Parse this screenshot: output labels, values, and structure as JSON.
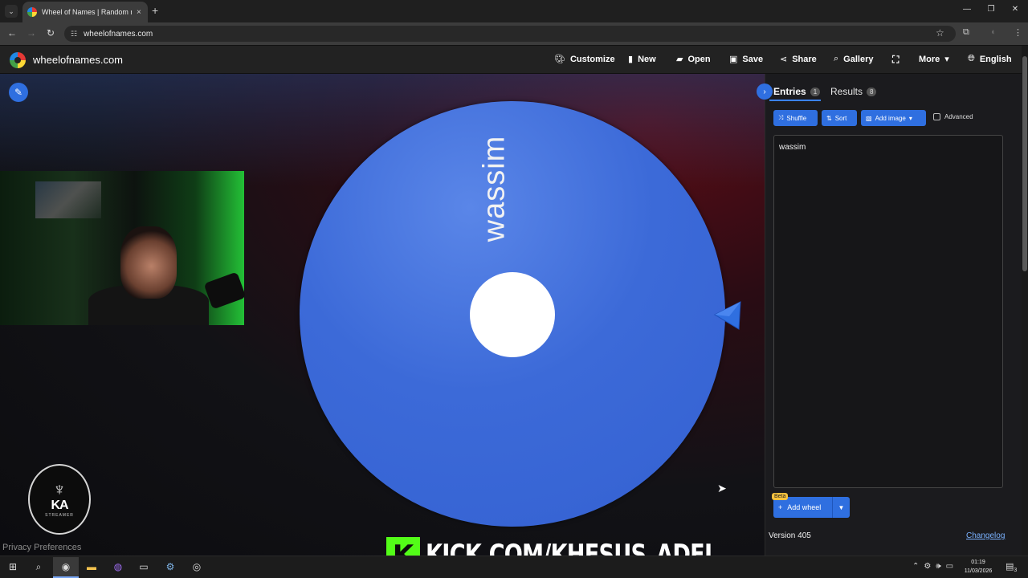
{
  "browser": {
    "tab_title": "Wheel of Names | Random name picker",
    "tab_close": "×",
    "new_tab": "+",
    "url": "wheelofnames.com",
    "window_controls": {
      "minimize": "—",
      "restore": "❐",
      "close": "✕"
    }
  },
  "site": {
    "name": "wheelofnames.com",
    "nav": {
      "customize": "Customize",
      "new": "New",
      "open": "Open",
      "save": "Save",
      "share": "Share",
      "gallery": "Gallery",
      "more": "More",
      "language": "English"
    }
  },
  "wheel": {
    "entries": [
      "wassim"
    ],
    "segment_color": "#3c6ad8",
    "pointer_color": "#2f6fe0"
  },
  "panel": {
    "tabs": {
      "entries_label": "Entries",
      "entries_count": "1",
      "results_label": "Results",
      "results_count": "8"
    },
    "buttons": {
      "shuffle": "Shuffle",
      "sort": "Sort",
      "add_image": "Add image",
      "advanced": "Advanced"
    },
    "entries_text": "wassim",
    "add_wheel": "Add wheel",
    "beta": "Beta",
    "version": "Version 405",
    "changelog": "Changelog"
  },
  "overlay": {
    "kick_letter": "K",
    "kick_url": "KICK.COM/KHESUS_ADEL",
    "stream_logo_letters": "KA",
    "stream_logo_sub": "STREAMER",
    "kick_color": "#53fc18"
  },
  "privacy": "Privacy Preferences",
  "taskbar": {
    "time": "01:19",
    "date": "11/03/2026",
    "notifications": "3"
  }
}
